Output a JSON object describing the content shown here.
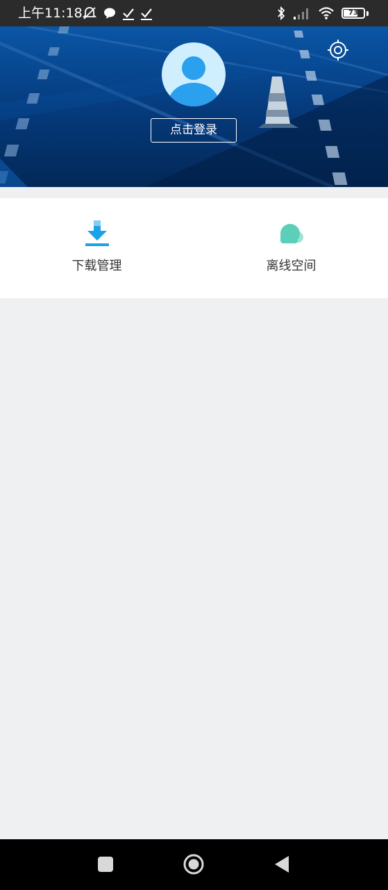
{
  "status_bar": {
    "time": "上午11:18",
    "battery_level": "73",
    "battery_fraction": 0.73,
    "icons_left": [
      "mute-alarm-icon",
      "chat-bubble-icon",
      "check-icon",
      "check-icon"
    ],
    "icons_right": [
      "bluetooth-icon",
      "signal-icon",
      "wifi-icon",
      "battery-icon"
    ]
  },
  "header": {
    "login_label": "点击登录",
    "avatar_icon": "user-avatar-icon",
    "settings_icon": "settings-icon"
  },
  "actions": [
    {
      "label": "下载管理",
      "icon": "download-icon",
      "color": "#1aa3e8"
    },
    {
      "label": "离线空间",
      "icon": "cloud-icon",
      "color": "#5ccfb8"
    }
  ],
  "nav_bar": {
    "buttons": [
      "recent-apps-icon",
      "home-icon",
      "back-icon"
    ]
  }
}
